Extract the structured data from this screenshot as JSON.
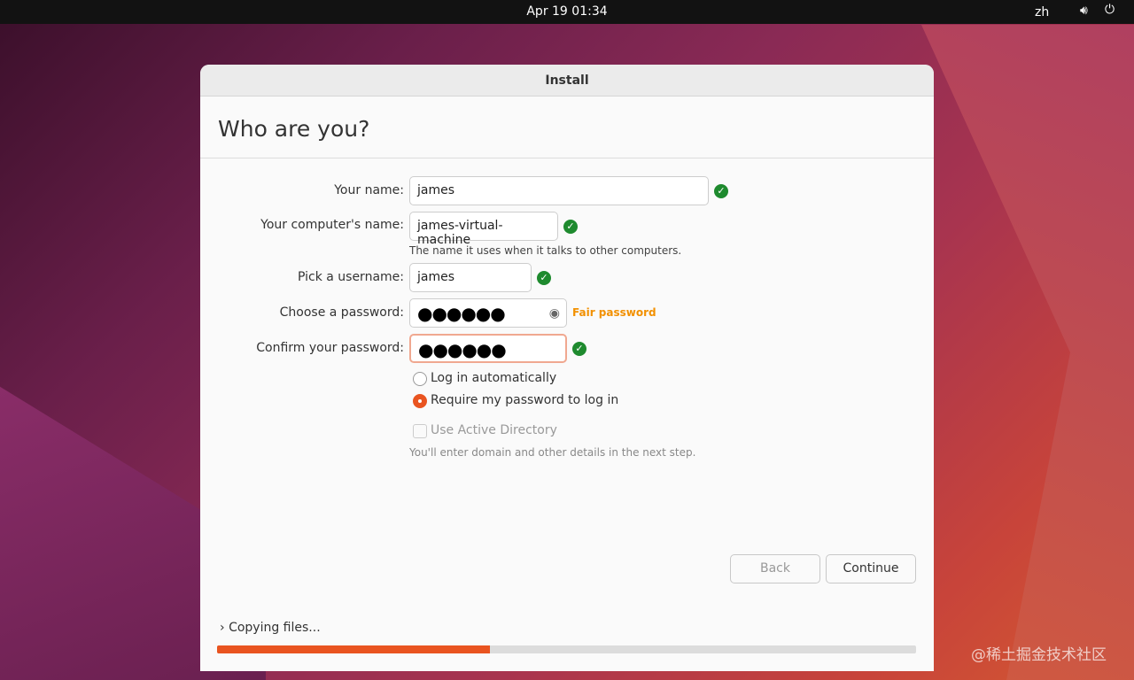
{
  "topbar": {
    "datetime": "Apr 19  01:34",
    "language": "zh",
    "icons": [
      "volume-icon",
      "power-icon"
    ]
  },
  "window": {
    "title": "Install",
    "heading": "Who are you?"
  },
  "form": {
    "name_label": "Your name:",
    "name_value": "james",
    "computer_label": "Your computer's name:",
    "computer_value": "james-virtual-machine",
    "computer_hint": "The name it uses when it talks to other computers.",
    "username_label": "Pick a username:",
    "username_value": "james",
    "password_label": "Choose a password:",
    "password_value": "●●●●●●",
    "password_strength": "Fair password",
    "confirm_label": "Confirm your password:",
    "confirm_value": "●●●●●●",
    "login_auto": "Log in automatically",
    "login_require": "Require my password to log in",
    "login_selected": "require",
    "active_directory": "Use Active Directory",
    "active_directory_checked": false,
    "active_directory_hint": "You'll enter domain and other details in the next step."
  },
  "buttons": {
    "back": "Back",
    "continue": "Continue"
  },
  "status": {
    "text": "Copying files...",
    "progress_percent": 39
  },
  "colors": {
    "accent": "#e95420",
    "success": "#1e8a2e",
    "warning": "#f29000"
  },
  "watermark": "@稀土掘金技术社区"
}
